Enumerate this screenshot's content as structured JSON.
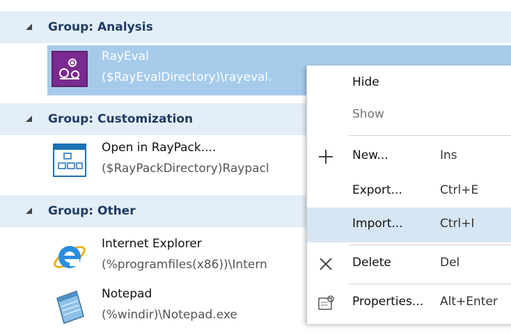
{
  "groups": [
    {
      "title": "Group: Analysis"
    },
    {
      "title": "Group: Customization"
    },
    {
      "title": "Group: Other"
    }
  ],
  "items": {
    "rayeval": {
      "name": "RayEval",
      "path": "($RayEvalDirectory)\\rayeval.",
      "icon": "gears-icon"
    },
    "raypack": {
      "name": "Open in RayPack....",
      "path": "($RayPackDirectory)Raypacl",
      "icon": "package-window-icon"
    },
    "ie": {
      "name": "Internet Explorer",
      "path": "(%programfiles(x86))\\Intern",
      "icon": "internet-explorer-icon"
    },
    "notepad": {
      "name": "Notepad",
      "path": "(%windir)\\Notepad.exe",
      "icon": "notepad-icon"
    }
  },
  "context_menu": {
    "hide": {
      "label": "Hide"
    },
    "show": {
      "label": "Show"
    },
    "new": {
      "label": "New...",
      "shortcut": "Ins",
      "icon": "plus-icon"
    },
    "export": {
      "label": "Export...",
      "shortcut": "Ctrl+E"
    },
    "import": {
      "label": "Import...",
      "shortcut": "Ctrl+I"
    },
    "delete": {
      "label": "Delete",
      "shortcut": "Del",
      "icon": "x-icon"
    },
    "properties": {
      "label": "Properties...",
      "shortcut": "Alt+Enter",
      "icon": "properties-icon"
    }
  },
  "colors": {
    "group_bg": "#e4eef8",
    "selected_bg": "#a6cbea",
    "menu_highlight": "#d7e6f3",
    "rayeval_icon": "#7a2b8f"
  }
}
